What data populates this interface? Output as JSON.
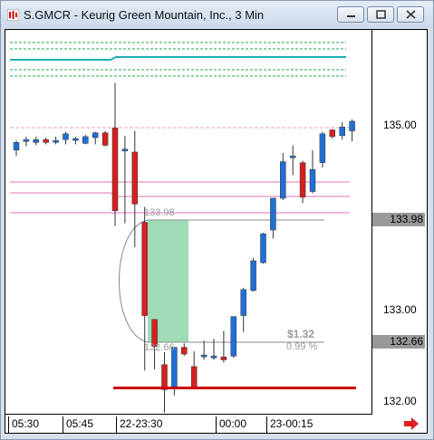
{
  "window": {
    "title": "S.GMCR - Keurig Green Mountain, Inc., 3 Min"
  },
  "chart": {
    "price_ticks": [
      {
        "label": "135.00",
        "price": 135.0
      },
      {
        "label": "133.00",
        "price": 133.0
      },
      {
        "label": "132.00",
        "price": 132.0
      }
    ],
    "price_tags": [
      {
        "label": "133.98",
        "price": 133.98
      },
      {
        "label": "132.66",
        "price": 132.66
      }
    ],
    "time_labels": [
      "05:30",
      "05:45",
      "22-23:30",
      "00:00",
      "23-00:15"
    ],
    "measurement": {
      "start_label": "133.98",
      "end_label": "132.66",
      "change": "$1.32",
      "pct": "0.99 %"
    },
    "colors": {
      "up": "#1f6fd6",
      "down": "#d42020",
      "teal": "#20b0b0",
      "green_dash": "#22aa44",
      "pink": "#e8a0c8",
      "shade": "#7fcf9f"
    }
  },
  "chart_data": {
    "type": "candlestick",
    "ylim": [
      131.98,
      135.98
    ],
    "candles": [
      {
        "o": 134.73,
        "h": 134.83,
        "l": 134.67,
        "c": 134.81
      },
      {
        "o": 134.82,
        "h": 134.87,
        "l": 134.77,
        "c": 134.84
      },
      {
        "o": 134.81,
        "h": 134.87,
        "l": 134.78,
        "c": 134.84
      },
      {
        "o": 134.84,
        "h": 134.86,
        "l": 134.79,
        "c": 134.81
      },
      {
        "o": 134.82,
        "h": 134.87,
        "l": 134.79,
        "c": 134.83
      },
      {
        "o": 134.84,
        "h": 134.92,
        "l": 134.79,
        "c": 134.9
      },
      {
        "o": 134.84,
        "h": 134.87,
        "l": 134.79,
        "c": 134.85
      },
      {
        "o": 134.8,
        "h": 134.89,
        "l": 134.79,
        "c": 134.87
      },
      {
        "o": 134.86,
        "h": 134.92,
        "l": 134.79,
        "c": 134.91
      },
      {
        "o": 134.91,
        "h": 134.93,
        "l": 134.77,
        "c": 134.78
      },
      {
        "o": 134.96,
        "h": 135.43,
        "l": 133.94,
        "c": 134.1
      },
      {
        "o": 134.73,
        "h": 134.88,
        "l": 133.97,
        "c": 134.74
      },
      {
        "o": 134.71,
        "h": 134.93,
        "l": 133.72,
        "c": 134.17
      },
      {
        "o": 133.98,
        "h": 134.14,
        "l": 132.44,
        "c": 133.01
      },
      {
        "o": 132.97,
        "h": 132.91,
        "l": 132.45,
        "c": 132.69
      },
      {
        "o": 132.5,
        "h": 132.63,
        "l": 132.0,
        "c": 132.24
      },
      {
        "o": 132.26,
        "h": 132.68,
        "l": 132.18,
        "c": 132.68
      },
      {
        "o": 132.68,
        "h": 132.72,
        "l": 132.59,
        "c": 132.61
      },
      {
        "o": 132.48,
        "h": 132.64,
        "l": 132.44,
        "c": 132.26
      },
      {
        "o": 132.6,
        "h": 132.75,
        "l": 132.55,
        "c": 132.6
      },
      {
        "o": 132.57,
        "h": 132.77,
        "l": 132.55,
        "c": 132.59
      },
      {
        "o": 132.58,
        "h": 132.85,
        "l": 132.52,
        "c": 132.55
      },
      {
        "o": 132.59,
        "h": 133.0,
        "l": 132.57,
        "c": 133.0
      },
      {
        "o": 133.01,
        "h": 133.3,
        "l": 132.84,
        "c": 133.28
      },
      {
        "o": 133.27,
        "h": 133.61,
        "l": 133.26,
        "c": 133.58
      },
      {
        "o": 133.56,
        "h": 133.87,
        "l": 133.55,
        "c": 133.86
      },
      {
        "o": 133.9,
        "h": 134.2,
        "l": 133.81,
        "c": 134.23
      },
      {
        "o": 134.23,
        "h": 134.7,
        "l": 134.21,
        "c": 134.61
      },
      {
        "o": 134.66,
        "h": 134.78,
        "l": 134.47,
        "c": 134.67
      },
      {
        "o": 134.6,
        "h": 134.62,
        "l": 134.18,
        "c": 134.24
      },
      {
        "o": 134.3,
        "h": 134.73,
        "l": 134.28,
        "c": 134.53
      },
      {
        "o": 134.6,
        "h": 134.92,
        "l": 134.55,
        "c": 134.9
      },
      {
        "o": 134.94,
        "h": 134.95,
        "l": 134.85,
        "c": 134.87
      },
      {
        "o": 134.88,
        "h": 135.02,
        "l": 134.84,
        "c": 134.97
      },
      {
        "o": 134.93,
        "h": 135.05,
        "l": 134.82,
        "c": 135.03
      }
    ]
  }
}
